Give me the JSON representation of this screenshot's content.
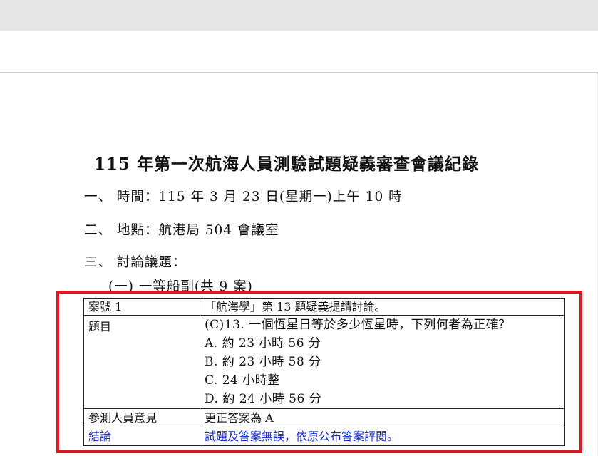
{
  "document": {
    "title": "115 年第一次航海人員測驗試題疑義審查會議紀錄",
    "items": [
      "一、 時間：115 年 3 月 23 日(星期一)上午 10 時",
      "二、 地點：航港局 504 會議室",
      "三、 討論議題："
    ],
    "subheading": "(一) 一等船副(共 9 案)"
  },
  "case": {
    "number_label": "案號 1",
    "proposal": "「航海學」第 13 題疑義提請討論。",
    "question_label": "題目",
    "question_lines": [
      "(C)13. 一個恆星日等於多少恆星時，下列何者為正確？",
      "A.  約 23 小時 56 分",
      "B.  約 23 小時 58 分",
      "C.  24 小時整",
      "D.  約 24 小時 56 分"
    ],
    "opinion_label": "參測人員意見",
    "opinion": "更正答案為 A",
    "conclusion_label": "結論",
    "conclusion": "試題及答案無誤，依原公布答案評閱。"
  },
  "colors": {
    "highlight_border": "#e0191f",
    "conclusion_text": "#1a2bd6"
  }
}
